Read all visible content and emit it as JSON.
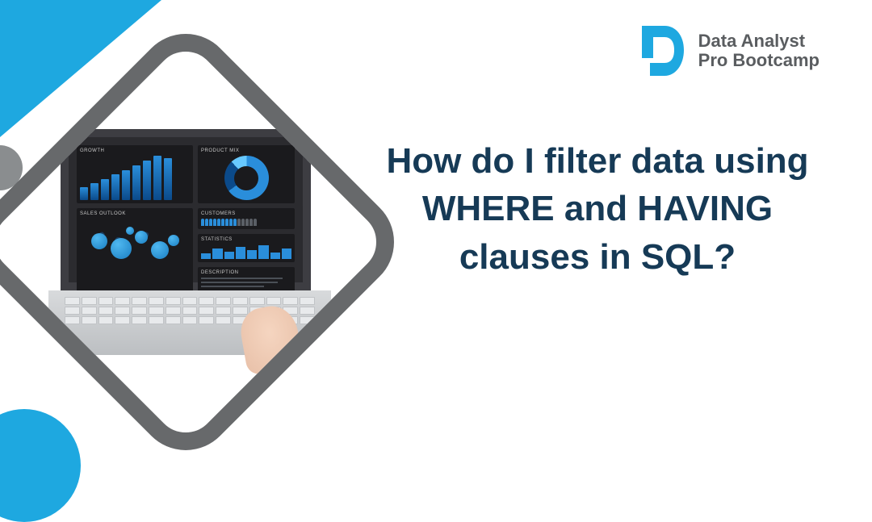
{
  "brand": {
    "line1": "Data Analyst",
    "line2": "Pro Bootcamp"
  },
  "headline": "How do I filter data using WHERE and HAVING clauses in SQL?",
  "dashboard": {
    "growth_label": "GROWTH",
    "product_mix_label": "PRODUCT MIX",
    "customers_label": "CUSTOMERS",
    "sales_outlook_label": "SALES OUTLOOK",
    "statistics_label": "STATISTICS",
    "description_label": "DESCRIPTION"
  },
  "colors": {
    "accent_blue": "#1ea8e0",
    "dark_navy": "#163a56",
    "grey": "#67696b"
  }
}
